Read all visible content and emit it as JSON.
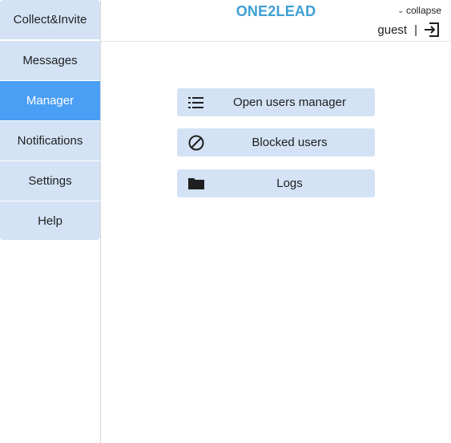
{
  "sidebar": {
    "items": [
      {
        "label": "Collect&Invite"
      },
      {
        "label": "Messages"
      },
      {
        "label": "Manager"
      },
      {
        "label": "Notifications"
      },
      {
        "label": "Settings"
      },
      {
        "label": "Help"
      }
    ],
    "active_item": "Manager"
  },
  "header": {
    "brand": "ONE2LEAD",
    "collapse_label": "collapse",
    "username": "guest",
    "separator": "|"
  },
  "main": {
    "buttons": [
      {
        "label": "Open users manager",
        "icon": "list-icon"
      },
      {
        "label": "Blocked users",
        "icon": "blocked-icon"
      },
      {
        "label": "Logs",
        "icon": "folder-icon"
      }
    ]
  },
  "colors": {
    "nav_bg": "#d3e3f5",
    "nav_active_bg": "#4a9ff5",
    "brand": "#3d9fd3"
  }
}
